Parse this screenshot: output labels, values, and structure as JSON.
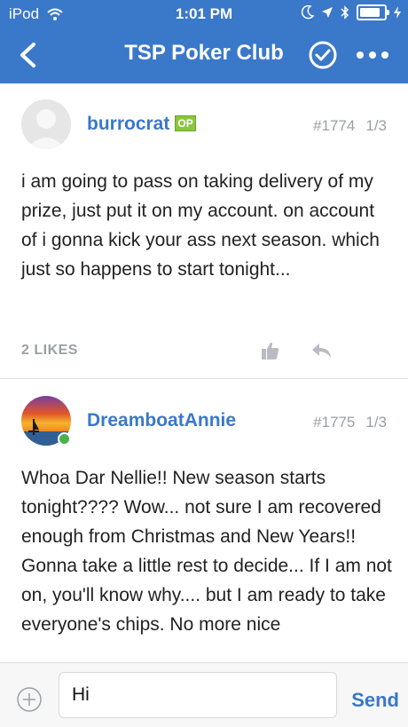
{
  "status_bar": {
    "carrier": "iPod",
    "time": "1:01 PM"
  },
  "nav": {
    "title": "TSP Poker Club"
  },
  "posts": [
    {
      "username": "burrocrat",
      "badge": "OP",
      "post_number": "#1774",
      "page": "1/3",
      "body": "i am going to pass on taking delivery of my prize, just put it on my account. on account of i gonna kick your ass next season. which just so happens to start tonight...",
      "likes": "2 LIKES"
    },
    {
      "username": "DreamboatAnnie",
      "post_number": "#1775",
      "page": "1/3",
      "body": "Whoa Dar Nellie!!   New season starts tonight????   Wow... not sure I am recovered enough from Christmas and New Years!!  Gonna take a little rest to decide... If I am not on, you'll know why.... but I am ready to take everyone's chips.  No more nice"
    }
  ],
  "composer": {
    "input_value": "Hi",
    "send_label": "Send"
  },
  "colors": {
    "brand": "#3a78c9",
    "op_badge": "#8cc63f",
    "online": "#4caf50"
  }
}
